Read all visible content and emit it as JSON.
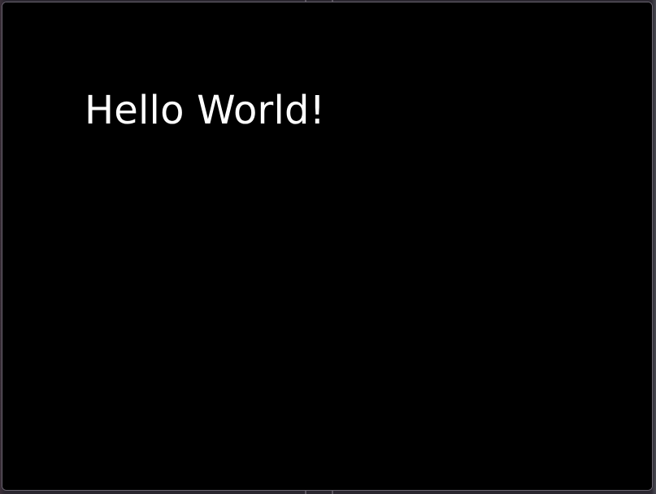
{
  "window": {
    "background": "#000000",
    "frame_color": "#6a6570"
  },
  "content": {
    "greeting": "Hello World!",
    "text_color": "#ffffff"
  }
}
